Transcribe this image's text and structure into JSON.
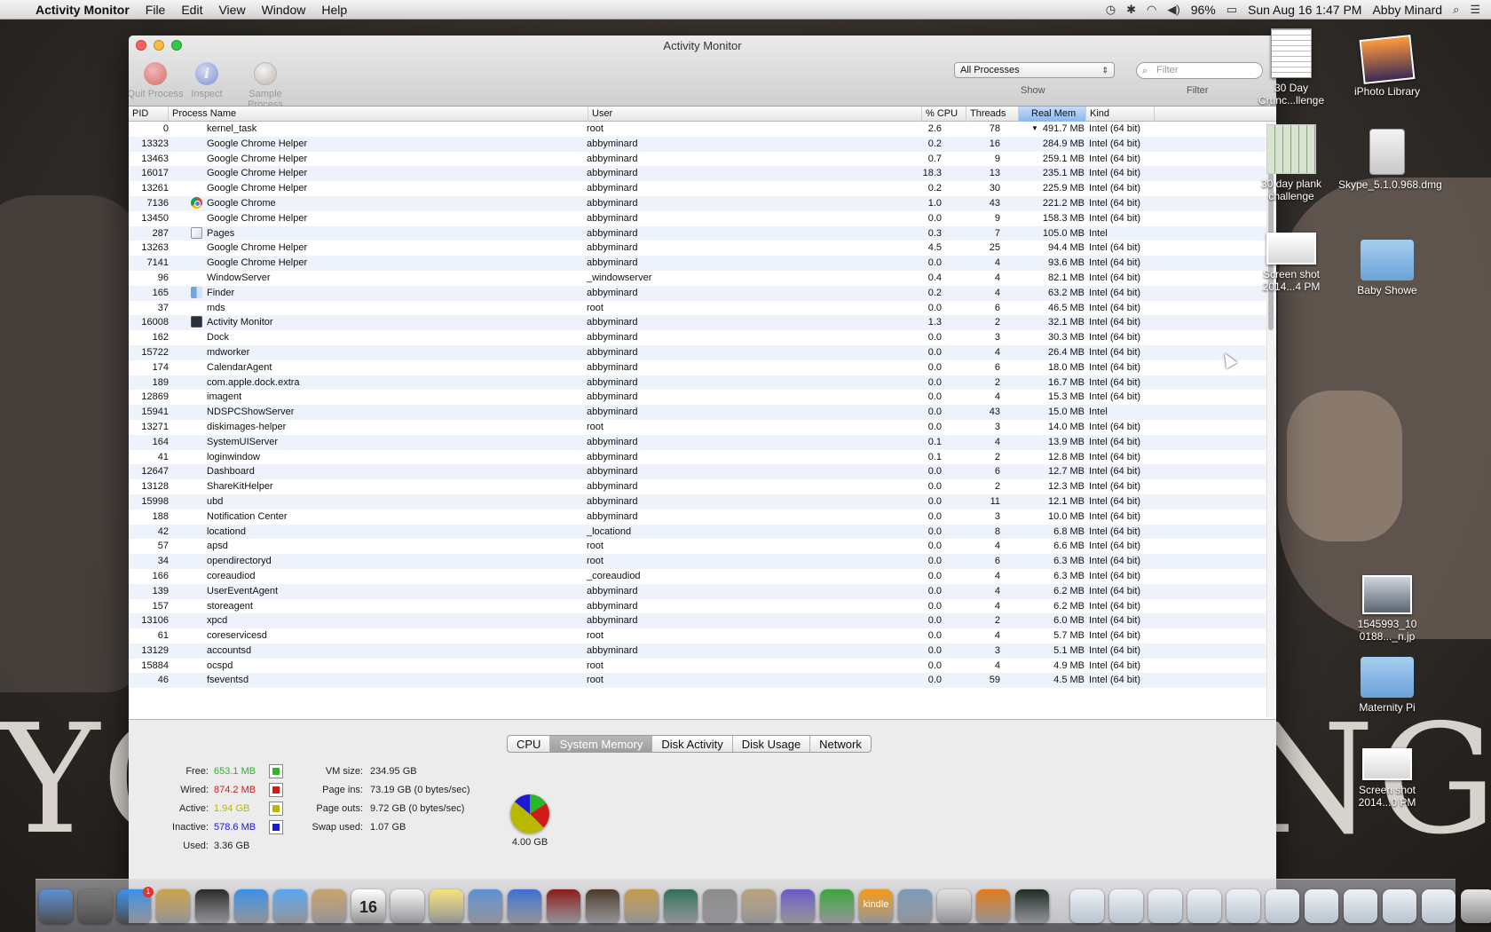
{
  "menubar": {
    "app_name": "Activity Monitor",
    "items": [
      "File",
      "Edit",
      "View",
      "Window",
      "Help"
    ],
    "battery": "96%",
    "datetime": "Sun Aug 16  1:47 PM",
    "user": "Abby Minard"
  },
  "window": {
    "title": "Activity Monitor",
    "toolbar": {
      "quit_label": "Quit Process",
      "inspect_label": "Inspect",
      "inspect_glyph": "i",
      "sample_label": "Sample Process"
    },
    "show_select": "All Processes",
    "show_label": "Show",
    "filter_placeholder": "Filter",
    "filter_label": "Filter"
  },
  "table": {
    "columns": {
      "pid": "PID",
      "name": "Process Name",
      "user": "User",
      "cpu": "% CPU",
      "threads": "Threads",
      "mem": "Real Mem",
      "kind": "Kind"
    },
    "sorted_column": "mem",
    "rows": [
      {
        "pid": "0",
        "name": "kernel_task",
        "icon": "",
        "user": "root",
        "cpu": "2.6",
        "threads": "78",
        "mem": "491.7 MB",
        "kind": "Intel (64 bit)"
      },
      {
        "pid": "13323",
        "name": "Google Chrome Helper",
        "icon": "",
        "user": "abbyminard",
        "cpu": "0.2",
        "threads": "16",
        "mem": "284.9 MB",
        "kind": "Intel (64 bit)"
      },
      {
        "pid": "13463",
        "name": "Google Chrome Helper",
        "icon": "",
        "user": "abbyminard",
        "cpu": "0.7",
        "threads": "9",
        "mem": "259.1 MB",
        "kind": "Intel (64 bit)"
      },
      {
        "pid": "16017",
        "name": "Google Chrome Helper",
        "icon": "",
        "user": "abbyminard",
        "cpu": "18.3",
        "threads": "13",
        "mem": "235.1 MB",
        "kind": "Intel (64 bit)"
      },
      {
        "pid": "13261",
        "name": "Google Chrome Helper",
        "icon": "",
        "user": "abbyminard",
        "cpu": "0.2",
        "threads": "30",
        "mem": "225.9 MB",
        "kind": "Intel (64 bit)"
      },
      {
        "pid": "7136",
        "name": "Google Chrome",
        "icon": "chrome-icon",
        "user": "abbyminard",
        "cpu": "1.0",
        "threads": "43",
        "mem": "221.2 MB",
        "kind": "Intel (64 bit)"
      },
      {
        "pid": "13450",
        "name": "Google Chrome Helper",
        "icon": "",
        "user": "abbyminard",
        "cpu": "0.0",
        "threads": "9",
        "mem": "158.3 MB",
        "kind": "Intel (64 bit)"
      },
      {
        "pid": "287",
        "name": "Pages",
        "icon": "pages-icon",
        "user": "abbyminard",
        "cpu": "0.3",
        "threads": "7",
        "mem": "105.0 MB",
        "kind": "Intel"
      },
      {
        "pid": "13263",
        "name": "Google Chrome Helper",
        "icon": "",
        "user": "abbyminard",
        "cpu": "4.5",
        "threads": "25",
        "mem": "94.4 MB",
        "kind": "Intel (64 bit)"
      },
      {
        "pid": "7141",
        "name": "Google Chrome Helper",
        "icon": "",
        "user": "abbyminard",
        "cpu": "0.0",
        "threads": "4",
        "mem": "93.6 MB",
        "kind": "Intel (64 bit)"
      },
      {
        "pid": "96",
        "name": "WindowServer",
        "icon": "",
        "user": "_windowserver",
        "cpu": "0.4",
        "threads": "4",
        "mem": "82.1 MB",
        "kind": "Intel (64 bit)"
      },
      {
        "pid": "165",
        "name": "Finder",
        "icon": "finder-icon",
        "user": "abbyminard",
        "cpu": "0.2",
        "threads": "4",
        "mem": "63.2 MB",
        "kind": "Intel (64 bit)"
      },
      {
        "pid": "37",
        "name": "mds",
        "icon": "",
        "user": "root",
        "cpu": "0.0",
        "threads": "6",
        "mem": "46.5 MB",
        "kind": "Intel (64 bit)"
      },
      {
        "pid": "16008",
        "name": "Activity Monitor",
        "icon": "activity-monitor-icon",
        "user": "abbyminard",
        "cpu": "1.3",
        "threads": "2",
        "mem": "32.1 MB",
        "kind": "Intel (64 bit)"
      },
      {
        "pid": "162",
        "name": "Dock",
        "icon": "",
        "user": "abbyminard",
        "cpu": "0.0",
        "threads": "3",
        "mem": "30.3 MB",
        "kind": "Intel (64 bit)"
      },
      {
        "pid": "15722",
        "name": "mdworker",
        "icon": "",
        "user": "abbyminard",
        "cpu": "0.0",
        "threads": "4",
        "mem": "26.4 MB",
        "kind": "Intel (64 bit)"
      },
      {
        "pid": "174",
        "name": "CalendarAgent",
        "icon": "",
        "user": "abbyminard",
        "cpu": "0.0",
        "threads": "6",
        "mem": "18.0 MB",
        "kind": "Intel (64 bit)"
      },
      {
        "pid": "189",
        "name": "com.apple.dock.extra",
        "icon": "",
        "user": "abbyminard",
        "cpu": "0.0",
        "threads": "2",
        "mem": "16.7 MB",
        "kind": "Intel (64 bit)"
      },
      {
        "pid": "12869",
        "name": "imagent",
        "icon": "",
        "user": "abbyminard",
        "cpu": "0.0",
        "threads": "4",
        "mem": "15.3 MB",
        "kind": "Intel (64 bit)"
      },
      {
        "pid": "15941",
        "name": "NDSPCShowServer",
        "icon": "",
        "user": "abbyminard",
        "cpu": "0.0",
        "threads": "43",
        "mem": "15.0 MB",
        "kind": "Intel"
      },
      {
        "pid": "13271",
        "name": "diskimages-helper",
        "icon": "",
        "user": "root",
        "cpu": "0.0",
        "threads": "3",
        "mem": "14.0 MB",
        "kind": "Intel (64 bit)"
      },
      {
        "pid": "164",
        "name": "SystemUIServer",
        "icon": "",
        "user": "abbyminard",
        "cpu": "0.1",
        "threads": "4",
        "mem": "13.9 MB",
        "kind": "Intel (64 bit)"
      },
      {
        "pid": "41",
        "name": "loginwindow",
        "icon": "",
        "user": "abbyminard",
        "cpu": "0.1",
        "threads": "2",
        "mem": "12.8 MB",
        "kind": "Intel (64 bit)"
      },
      {
        "pid": "12647",
        "name": "Dashboard",
        "icon": "",
        "user": "abbyminard",
        "cpu": "0.0",
        "threads": "6",
        "mem": "12.7 MB",
        "kind": "Intel (64 bit)"
      },
      {
        "pid": "13128",
        "name": "ShareKitHelper",
        "icon": "",
        "user": "abbyminard",
        "cpu": "0.0",
        "threads": "2",
        "mem": "12.3 MB",
        "kind": "Intel (64 bit)"
      },
      {
        "pid": "15998",
        "name": "ubd",
        "icon": "",
        "user": "abbyminard",
        "cpu": "0.0",
        "threads": "11",
        "mem": "12.1 MB",
        "kind": "Intel (64 bit)"
      },
      {
        "pid": "188",
        "name": "Notification Center",
        "icon": "",
        "user": "abbyminard",
        "cpu": "0.0",
        "threads": "3",
        "mem": "10.0 MB",
        "kind": "Intel (64 bit)"
      },
      {
        "pid": "42",
        "name": "locationd",
        "icon": "",
        "user": "_locationd",
        "cpu": "0.0",
        "threads": "8",
        "mem": "6.8 MB",
        "kind": "Intel (64 bit)"
      },
      {
        "pid": "57",
        "name": "apsd",
        "icon": "",
        "user": "root",
        "cpu": "0.0",
        "threads": "4",
        "mem": "6.6 MB",
        "kind": "Intel (64 bit)"
      },
      {
        "pid": "34",
        "name": "opendirectoryd",
        "icon": "",
        "user": "root",
        "cpu": "0.0",
        "threads": "6",
        "mem": "6.3 MB",
        "kind": "Intel (64 bit)"
      },
      {
        "pid": "166",
        "name": "coreaudiod",
        "icon": "",
        "user": "_coreaudiod",
        "cpu": "0.0",
        "threads": "4",
        "mem": "6.3 MB",
        "kind": "Intel (64 bit)"
      },
      {
        "pid": "139",
        "name": "UserEventAgent",
        "icon": "",
        "user": "abbyminard",
        "cpu": "0.0",
        "threads": "4",
        "mem": "6.2 MB",
        "kind": "Intel (64 bit)"
      },
      {
        "pid": "157",
        "name": "storeagent",
        "icon": "",
        "user": "abbyminard",
        "cpu": "0.0",
        "threads": "4",
        "mem": "6.2 MB",
        "kind": "Intel (64 bit)"
      },
      {
        "pid": "13106",
        "name": "xpcd",
        "icon": "",
        "user": "abbyminard",
        "cpu": "0.0",
        "threads": "2",
        "mem": "6.0 MB",
        "kind": "Intel (64 bit)"
      },
      {
        "pid": "61",
        "name": "coreservicesd",
        "icon": "",
        "user": "root",
        "cpu": "0.0",
        "threads": "4",
        "mem": "5.7 MB",
        "kind": "Intel (64 bit)"
      },
      {
        "pid": "13129",
        "name": "accountsd",
        "icon": "",
        "user": "abbyminard",
        "cpu": "0.0",
        "threads": "3",
        "mem": "5.1 MB",
        "kind": "Intel (64 bit)"
      },
      {
        "pid": "15884",
        "name": "ocspd",
        "icon": "",
        "user": "root",
        "cpu": "0.0",
        "threads": "4",
        "mem": "4.9 MB",
        "kind": "Intel (64 bit)"
      },
      {
        "pid": "46",
        "name": "fseventsd",
        "icon": "",
        "user": "root",
        "cpu": "0.0",
        "threads": "59",
        "mem": "4.5 MB",
        "kind": "Intel (64 bit)"
      }
    ]
  },
  "bottom": {
    "tabs": [
      "CPU",
      "System Memory",
      "Disk Activity",
      "Disk Usage",
      "Network"
    ],
    "active_tab": "System Memory",
    "memory": {
      "free_label": "Free:",
      "free": "653.1 MB",
      "free_color": "#2bb52b",
      "wired_label": "Wired:",
      "wired": "874.2 MB",
      "wired_color": "#d11a1a",
      "active_label": "Active:",
      "active": "1.94 GB",
      "active_color": "#b8b800",
      "inactive_label": "Inactive:",
      "inactive": "578.6 MB",
      "inactive_color": "#1a1ad1",
      "used_label": "Used:",
      "used": "3.36 GB"
    },
    "vm": {
      "vm_size_label": "VM size:",
      "vm_size": "234.95 GB",
      "page_ins_label": "Page ins:",
      "page_ins": "73.19 GB (0 bytes/sec)",
      "page_outs_label": "Page outs:",
      "page_outs": "9.72 GB (0 bytes/sec)",
      "swap_label": "Swap used:",
      "swap": "1.07 GB"
    },
    "total": "4.00 GB"
  },
  "desktop": {
    "icons": [
      {
        "label": "30 Day Crunc...llenge",
        "kind": "doc"
      },
      {
        "label": "iPhoto Library",
        "kind": "iphoto"
      },
      {
        "label": "30 day plank challenge",
        "kind": "green"
      },
      {
        "label": "Skype_5.1.0.968.dmg",
        "kind": "dmg"
      },
      {
        "label": "Screen shot 2014...4 PM",
        "kind": "shot"
      },
      {
        "label": "Baby Showe",
        "kind": "folder"
      },
      {
        "label": "1545993_10 0188..._n.jp",
        "kind": "photo"
      },
      {
        "label": "Maternity Pi",
        "kind": "folder"
      },
      {
        "label": "Screen shot 2014...0 PM",
        "kind": "shot"
      }
    ],
    "backdrop_left": "YO",
    "backdrop_right": "NG."
  },
  "dock": {
    "items": [
      "finder-icon",
      "launchpad-icon",
      "app-store-icon",
      "mail-stamp-icon",
      "dashboard-icon",
      "safari-icon",
      "messages-icon",
      "contacts-icon",
      "calendar-icon",
      "reminders-icon",
      "notes-icon",
      "iphoto-icon",
      "itunes-icon",
      "photo-booth-icon",
      "imovie-icon",
      "garageband-icon",
      "time-machine-icon",
      "system-preferences-icon",
      "keynote-icon",
      "pages-icon",
      "numbers-icon",
      "kindle-icon",
      "preview-icon",
      "chrome-icon",
      "firefox-icon",
      "activity-monitor-icon"
    ],
    "calendar_date": "16",
    "app_store_badge": "1",
    "kindle_label": "kindle"
  }
}
